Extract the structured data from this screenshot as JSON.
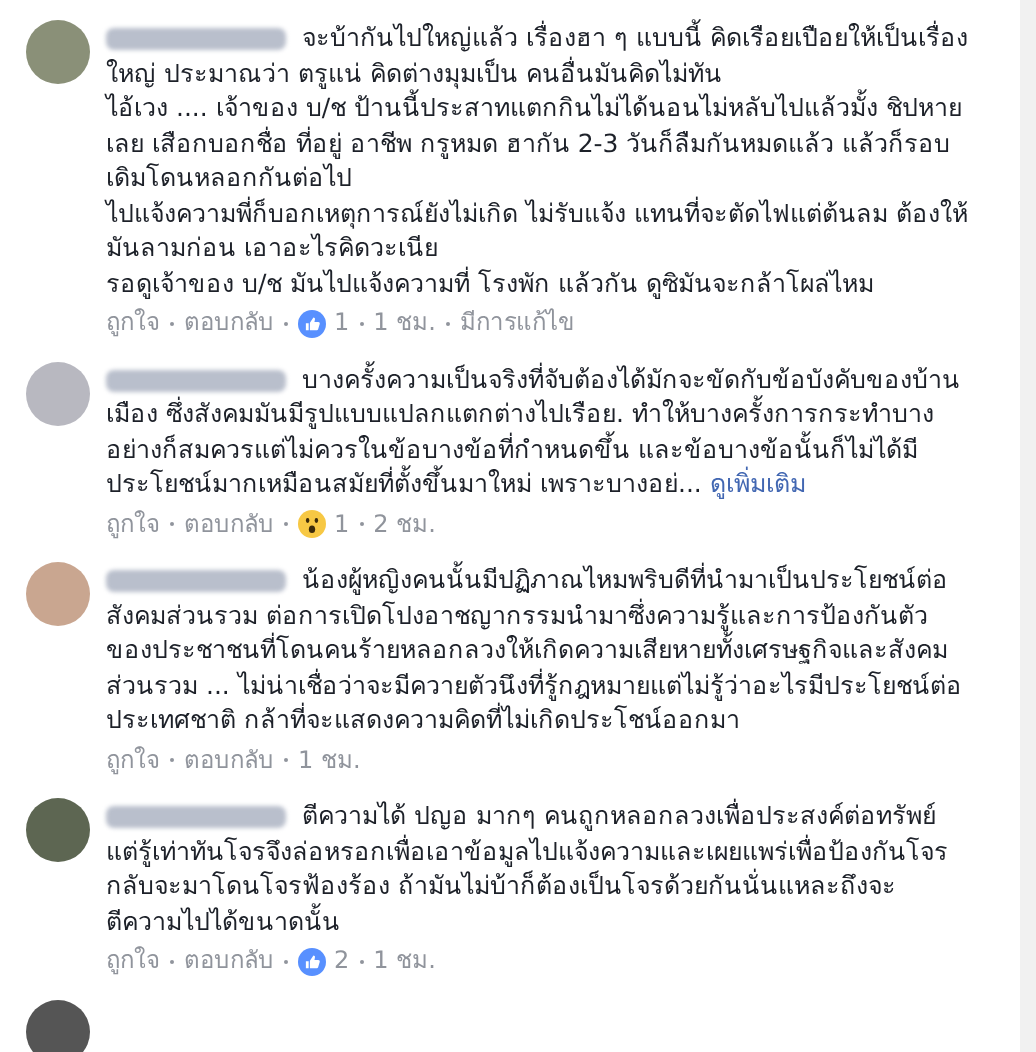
{
  "comments": [
    {
      "paragraphs": [
        "จะบ้ากันไปใหญ่แล้ว เรื่องฮา ๆ แบบนี้ คิดเรือยเปือยให้เป็นเรื่องใหญ่ ประมาณว่า ตรูแน่ คิดต่างมุมเป็น คนอื่นมันคิดไม่ทัน",
        "ไอ้เวง .... เจ้าของ บ/ช ป้านนี้ประสาทแตกกินไม่ได้นอนไม่หลับไปแล้วมั้ง ชิปหายเลย เสือกบอกชื่อ ที่อยู่ อาชีพ กรูหมด ฮากัน 2-3 วันก็ลืมกันหมดแล้ว แล้วก็รอบเดิมโดนหลอกกันต่อไป",
        "ไปแจ้งความพี่ก็บอกเหตุการณ์ยังไม่เกิด ไม่รับแจ้ง แทนที่จะตัดไฟแต่ต้นลม ต้องให้มันลามก่อน เอาอะไรคิดวะเนีย",
        "รอดูเจ้าของ บ/ช มันไปแจ้งความที่ โรงพัก แล้วกัน ดูซิมันจะกล้าโผล่ไหม"
      ],
      "like": "ถูกใจ",
      "reply": "ตอบกลับ",
      "reaction": {
        "kind": "like",
        "count": "1"
      },
      "time": "1 ชม.",
      "edited": "มีการแก้ไข"
    },
    {
      "paragraphs": [
        "บางครั้งความเป็นจริงที่จับต้องได้มักจะขัดกับข้อบังคับของบ้านเมือง ซึ่งสังคมมันมีรูปแบบแปลกแตกต่างไปเรือย. ทำให้บางครั้งการกระทำบางอย่างก็สมควรแต่ไม่ควรในข้อบางข้อที่กำหนดขึ้น และข้อบางข้อนั้นก็ไม่ได้มีประโยชน์มากเหมือนสมัยที่ตั้งขึ้นมาใหม่ เพราะบางอย่..."
      ],
      "more": "ดูเพิ่มเติม",
      "like": "ถูกใจ",
      "reply": "ตอบกลับ",
      "reaction": {
        "kind": "wow",
        "count": "1"
      },
      "time": "2 ชม."
    },
    {
      "paragraphs": [
        "น้องผู้หญิงคนนั้นมีปฏิภาณไหมพริบดีที่นำมาเป็นประโยชน์ต่อสังคมส่วนรวม ต่อการเปิดโปงอาชญากรรมนำมาซึ่งความรู้และการป้องกันตัวของประชาชนที่โดนคนร้ายหลอกลวงให้เกิดความเสียหายทั้งเศรษฐกิจและสังคมส่วนรวม ... ไม่น่าเชื่อว่าจะมีควายตัวนึงที่รู้กฎหมายแต่ไม่รู้ว่าอะไรมีประโยชน์ต่อประเทศชาติ กล้าที่จะแสดงความคิดที่ไม่เกิดประโชน์ออกมา"
      ],
      "like": "ถูกใจ",
      "reply": "ตอบกลับ",
      "time": "1 ชม."
    },
    {
      "paragraphs": [
        "ตีความได้ ปญอ มากๆ คนถูกหลอกลวงเพื่อประสงค์ต่อทรัพย์ แต่รู้เท่าทันโจรจึงล่อหรอกเพื่อเอาข้อมูลไปแจ้งความและเผยแพร่เพื่อป้องกันโจรกลับจะมาโดนโจรฟ้องร้อง ถ้ามันไม่บ้าก็ต้องเป็นโจรด้วยกันนั่นแหละถึงจะตีความไปได้ขนาดนั้น"
      ],
      "like": "ถูกใจ",
      "reply": "ตอบกลับ",
      "reaction": {
        "kind": "like",
        "count": "2"
      },
      "time": "1 ชม."
    }
  ]
}
